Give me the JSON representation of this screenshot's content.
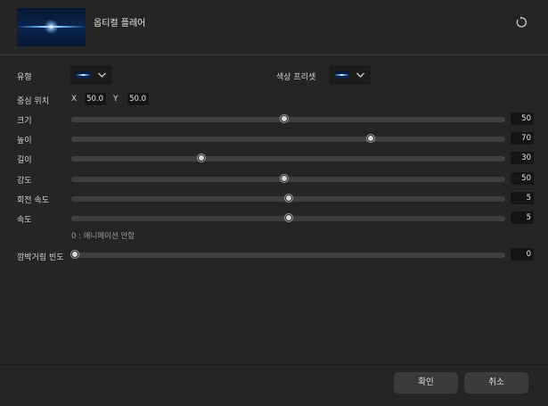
{
  "header": {
    "title": "옵티컬 플레어"
  },
  "type_row": {
    "label": "유형"
  },
  "preset_row": {
    "label": "색상 프리셋"
  },
  "center": {
    "label": "중심 위치",
    "x_label": "X",
    "x_value": "50.0",
    "y_label": "Y",
    "y_value": "50.0"
  },
  "sliders": [
    {
      "label": "크기",
      "value": "50",
      "fraction": 0.49
    },
    {
      "label": "높이",
      "value": "70",
      "fraction": 0.69
    },
    {
      "label": "길이",
      "value": "30",
      "fraction": 0.3
    },
    {
      "label": "강도",
      "value": "50",
      "fraction": 0.49
    },
    {
      "label": "회전 속도",
      "value": "5",
      "fraction": 0.5
    },
    {
      "label": "속도",
      "value": "5",
      "fraction": 0.5
    }
  ],
  "hint": "0 : 애니메이션 안함",
  "flicker": {
    "label": "깜박거림 빈도",
    "value": "0",
    "fraction": 0.0
  },
  "footer": {
    "ok_label": "확인",
    "cancel_label": "취소"
  },
  "colors": {
    "background": "#252525",
    "track": "#3f3f3f",
    "button": "#3b3b3b"
  }
}
